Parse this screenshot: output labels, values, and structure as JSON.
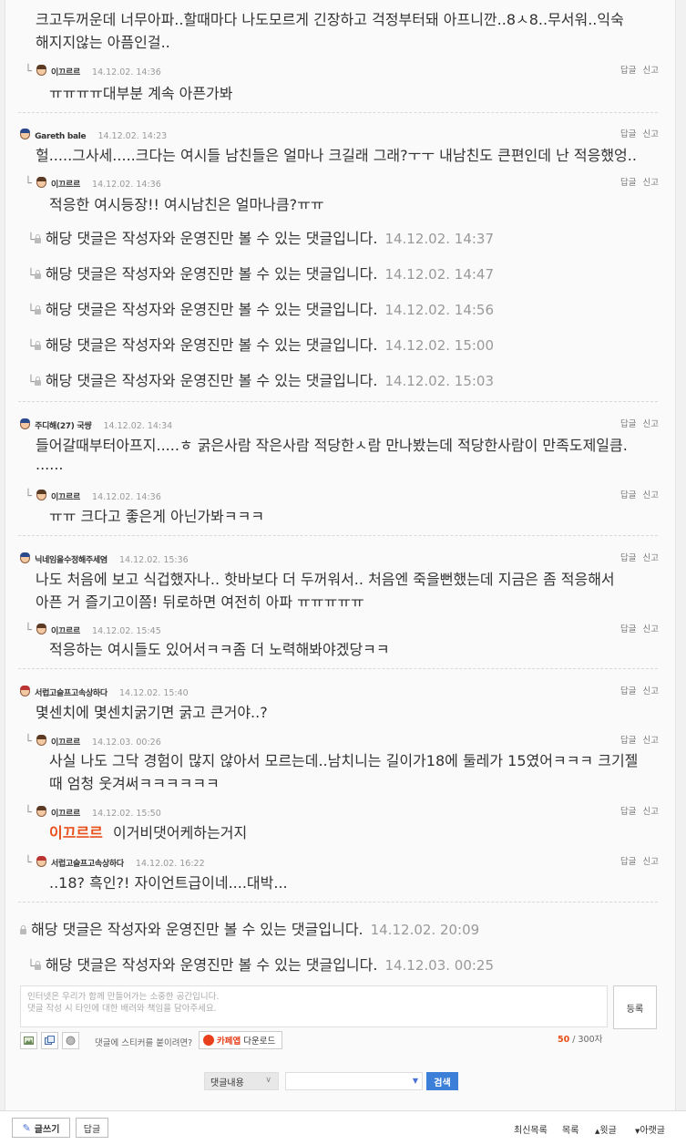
{
  "actions": {
    "reply": "답글",
    "report": "신고"
  },
  "comments": {
    "c1": {
      "line1": "크고두꺼운데 너무아파..할때마다 나도모르게 긴장하고 걱정부터돼 아프니깐..8ㅅ8..무서워..익숙",
      "line2": "해지지않는 아픔인걸.."
    },
    "r1": {
      "author": "이끄르르",
      "date": "14.12.02. 14:36",
      "text": "ㅠㅠㅠㅠ대부분 계속 아픈가봐"
    },
    "c2": {
      "author": "Gareth bale",
      "date": "14.12.02. 14:23",
      "text": "헐.....그사세.....크다는 여시들 남친들은 얼마나 크길래 그래?ㅜㅜ 내남친도 큰편인데 난 적응했엉.."
    },
    "r2": {
      "author": "이끄르르",
      "date": "14.12.02. 14:36",
      "text": "적응한 여시등장!! 여시남친은 얼마나큼?ㅠㅠ"
    },
    "secret_text": "해당 댓글은 작성자와 운영진만 볼 수 있는 댓글입니다.",
    "secret_times": [
      "14.12.02. 14:37",
      "14.12.02. 14:47",
      "14.12.02. 14:56",
      "14.12.02. 15:00",
      "14.12.02. 15:03"
    ],
    "c3": {
      "author": "주디해(27) 국썅",
      "date": "14.12.02. 14:34",
      "line1": "들어갈때부터아프지.....ㅎ 굵은사람 작은사람 적당한ㅅ람 만나봤는데 적당한사람이 만족도제일큼.",
      "line2": "......"
    },
    "r3": {
      "author": "이끄르르",
      "date": "14.12.02. 14:36",
      "text": "ㅠㅠ 크다고 좋은게 아닌가봐ㅋㅋㅋ"
    },
    "c4": {
      "author": "닉네임을수정해주세염",
      "date": "14.12.02. 15:36",
      "line1": "나도 처음에 보고 식겁했자나.. 핫바보다 더 두꺼워서.. 처음엔 죽을뻔했는데 지금은 좀 적응해서",
      "line2": "아픈 거 즐기고이쯤! 뒤로하면 여전히 아파 ㅠㅠㅠㅠㅠ"
    },
    "r4": {
      "author": "이끄르르",
      "date": "14.12.02. 15:45",
      "text": "적응하는 여시들도 있어서ㅋㅋ좀 더 노력해봐야겠당ㅋㅋ"
    },
    "c5": {
      "author": "서럽고슬프고속상하다",
      "date": "14.12.02. 15:40",
      "text": "몇센치에 몇센치굵기면 굵고 큰거야..?"
    },
    "r5": {
      "author": "이끄르르",
      "date": "14.12.03. 00:26",
      "line1": "사실 나도 그닥 경험이 많지 않아서 모르는데..남치니는 길이가18에 둘레가 15였어ㅋㅋㅋ 크기젤",
      "line2": "때 엄청 웃겨써ㅋㅋㅋㅋㅋㅋ"
    },
    "r6": {
      "author": "이끄르르",
      "date": "14.12.02. 15:50",
      "mention": "이끄르르",
      "text": "이거비댓어케하는거지"
    },
    "r7": {
      "author": "서럽고슬프고속상하다",
      "date": "14.12.02. 16:22",
      "text": "..18? 흑인?! 자이언트급이네....대박..."
    },
    "s6_time": "14.12.02. 20:09",
    "s7_time": "14.12.03. 00:25"
  },
  "comment_form": {
    "placeholder_line1": "인터넷은 우리가 함께 만들어가는 소중한 공간입니다.",
    "placeholder_line2": "댓글 작성 시 타인에 대한 배려와 책임을 담아주세요.",
    "submit": "등록",
    "sticker_prompt": "댓글에 스티커를 붙이려면?",
    "cafe_app_label": "카페앱",
    "cafe_app_download": "다운로드",
    "counter_current": "50",
    "counter_max": "/ 300자"
  },
  "search": {
    "select_value": "댓글내용",
    "button": "검색"
  },
  "bottom_bar": {
    "write": "글쓰기",
    "reply": "답글",
    "latest": "최신목록",
    "list": "목록",
    "prev": "윗글",
    "next": "아랫글"
  },
  "colors": {
    "accent": "#3b7fd8",
    "mention": "#e8501a",
    "cafe_red": "#e8401c"
  }
}
